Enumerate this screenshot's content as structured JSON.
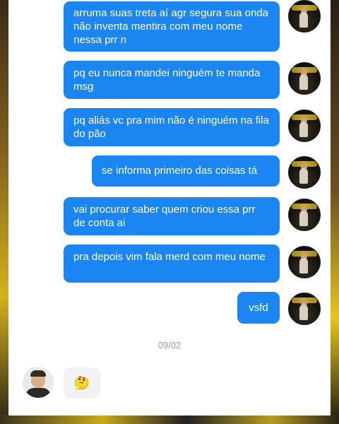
{
  "messages": [
    {
      "text": "arruma suas treta aí agr segura sua onda não inventa mentira com meu nome nessa prr n"
    },
    {
      "text": "pq eu nunca mandei ninguém te manda msg"
    },
    {
      "text": "pq aliás vc pra mim não é ninguém na fila do pão"
    },
    {
      "text": "se informa primeiro das coisas tá"
    },
    {
      "text": "vai procurar saber quem criou essa prr de conta ai"
    },
    {
      "text": "pra depois vim fala merd com meu nome"
    },
    {
      "text": "vsfd"
    }
  ],
  "date_label": "09/02",
  "reply": {
    "emoji": "🤔"
  },
  "colors": {
    "bubble": "#1b86f2",
    "bubble_text": "#ffffff",
    "background": "#ffffff"
  }
}
